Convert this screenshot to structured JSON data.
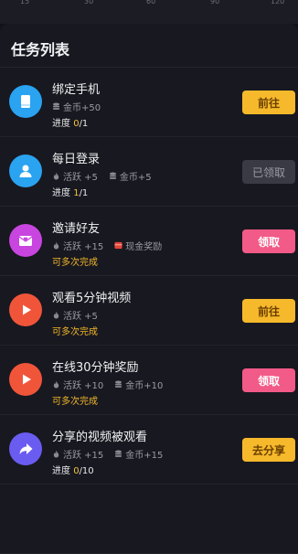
{
  "scale_ticks": [
    "15",
    "30",
    "60",
    "90",
    "120"
  ],
  "header": {
    "title": "任务列表"
  },
  "colors": {
    "accent_yellow": "#f6b92b",
    "accent_pink": "#f25a87",
    "claimed_gray": "#3a3a45",
    "highlight_orange": "#f0b62a"
  },
  "tasks": [
    {
      "title": "绑定手机",
      "icon": "phone-book-icon",
      "icon_color": "#2aa3f0",
      "rewards": [
        {
          "icon": "coin-stack-icon",
          "text": "金币+50"
        }
      ],
      "progress_label": "进度",
      "progress_current": "0",
      "progress_total": "/1",
      "button": "前往",
      "button_style": "yellow"
    },
    {
      "title": "每日登录",
      "icon": "user-icon",
      "icon_color": "#2aa3f0",
      "rewards": [
        {
          "icon": "flame-icon",
          "text": "活跃 +5"
        },
        {
          "icon": "coin-stack-icon",
          "text": "金币+5"
        }
      ],
      "progress_label": "进度",
      "progress_current": "1",
      "progress_total": "/1",
      "button": "已领取",
      "button_style": "gray"
    },
    {
      "title": "邀请好友",
      "icon": "envelope-heart-icon",
      "icon_color": "#c845e0",
      "rewards": [
        {
          "icon": "flame-icon",
          "text": "活跃 +15"
        },
        {
          "icon": "cash-icon",
          "text": "现金奖励"
        }
      ],
      "repeat": "可多次完成",
      "button": "领取",
      "button_style": "pink"
    },
    {
      "title": "观看5分钟视频",
      "icon": "play-icon",
      "icon_color": "#f0553a",
      "rewards": [
        {
          "icon": "flame-icon",
          "text": "活跃 +5"
        }
      ],
      "repeat": "可多次完成",
      "button": "前往",
      "button_style": "yellow"
    },
    {
      "title": "在线30分钟奖励",
      "icon": "play-icon",
      "icon_color": "#f0553a",
      "rewards": [
        {
          "icon": "flame-icon",
          "text": "活跃 +10"
        },
        {
          "icon": "coin-stack-icon",
          "text": "金币+10"
        }
      ],
      "repeat": "可多次完成",
      "button": "领取",
      "button_style": "pink"
    },
    {
      "title": "分享的视频被观看",
      "icon": "share-arrow-icon",
      "icon_color": "#6a5cf0",
      "rewards": [
        {
          "icon": "flame-icon",
          "text": "活跃 +15"
        },
        {
          "icon": "coin-stack-icon",
          "text": "金币+15"
        }
      ],
      "progress_label": "进度",
      "progress_current": "0",
      "progress_total": "/10",
      "button": "去分享",
      "button_style": "yellow"
    }
  ]
}
